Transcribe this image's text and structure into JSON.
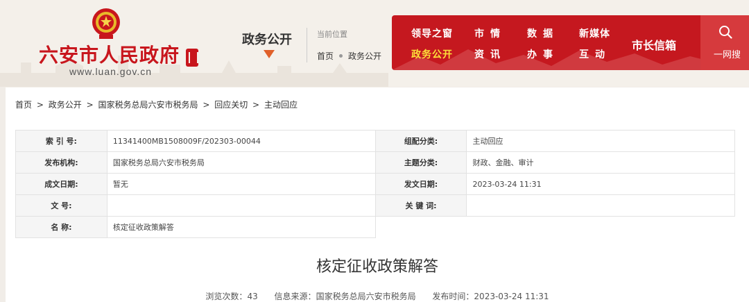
{
  "header": {
    "site_title": "六安市人民政府",
    "site_url": "www.luan.gov.cn",
    "section_title": "政务公开",
    "location_label": "当前位置",
    "location_path": [
      "首页",
      "政务公开"
    ]
  },
  "nav": {
    "items": [
      {
        "label": "领导之窗",
        "active": false
      },
      {
        "label": "市情",
        "active": false
      },
      {
        "label": "数据",
        "active": false
      },
      {
        "label": "新媒体",
        "active": false
      },
      {
        "label": "政务公开",
        "active": true
      },
      {
        "label": "资讯",
        "active": false
      },
      {
        "label": "办事",
        "active": false
      },
      {
        "label": "互动",
        "active": false
      }
    ],
    "mayor_mailbox": "市长信箱",
    "search_label": "一网搜",
    "search_icon": "search-icon"
  },
  "breadcrumb": [
    "首页",
    ">",
    "政务公开",
    ">",
    "国家税务总局六安市税务局",
    ">",
    "回应关切",
    ">",
    "主动回应"
  ],
  "meta": {
    "index_no_label": "索 引 号:",
    "index_no": "11341400MB1508009F/202303-00044",
    "category_label": "组配分类:",
    "category": "主动回应",
    "publisher_label": "发布机构:",
    "publisher": "国家税务总局六安市税务局",
    "topic_label": "主题分类:",
    "topic": "财政、金融、审计",
    "created_label": "成文日期:",
    "created": "暂无",
    "published_label": "发文日期:",
    "published": "2023-03-24 11:31",
    "doc_no_label": "文 号:",
    "doc_no": "",
    "keywords_label": "关 键 词:",
    "keywords": "",
    "name_label": "名 称:",
    "name": "核定征收政策解答"
  },
  "article": {
    "title": "核定征收政策解答",
    "views_label": "浏览次数：",
    "views": "43",
    "source_label": "信息来源：",
    "source": "国家税务总局六安市税务局",
    "time_label": "发布时间：",
    "time": "2023-03-24 11:31"
  },
  "colors": {
    "brand_red": "#c5181f",
    "active_nav": "#fde03a",
    "background": "#f1ede8"
  }
}
